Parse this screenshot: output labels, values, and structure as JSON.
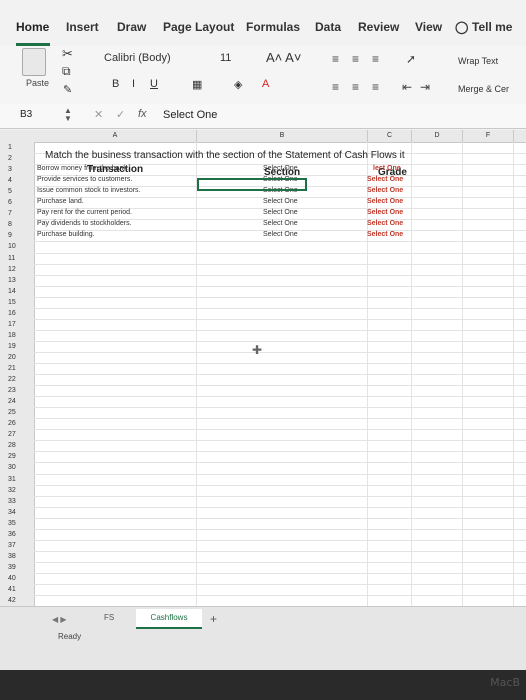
{
  "ribbon_tabs": [
    "Home",
    "Insert",
    "Draw",
    "Page Layout",
    "Formulas",
    "Data",
    "Review",
    "View",
    "Tell me"
  ],
  "ribbon": {
    "paste_label": "Paste",
    "font_name": "Calibri (Body)",
    "font_size": "11",
    "grow_label": "A˄ A˅",
    "bold": "B",
    "italic": "I",
    "underline": "U",
    "wrap_text": "Wrap Text",
    "merge": "Merge & Cer"
  },
  "formula_bar": {
    "name_box": "B3",
    "fx": "fx",
    "content": "Select One"
  },
  "columns": [
    "A",
    "B",
    "C",
    "D",
    "F"
  ],
  "rows": [
    "1",
    "2",
    "3",
    "4",
    "5",
    "6",
    "7",
    "8",
    "9",
    "10",
    "11",
    "12",
    "13",
    "14",
    "15",
    "16",
    "17",
    "18",
    "19",
    "20",
    "21",
    "22",
    "23",
    "24",
    "25",
    "26",
    "27",
    "28",
    "29",
    "30",
    "31",
    "32",
    "33",
    "34",
    "35",
    "36",
    "37",
    "38",
    "39",
    "40",
    "41",
    "42"
  ],
  "sheet": {
    "title": "Match the business transaction with the section of the Statement of Cash Flows it",
    "header_transaction": "Transaction",
    "header_section": "Section",
    "header_grade": "Grade",
    "transactions": [
      "Borrow money from the bank.",
      "Provide services to customers.",
      "Issue common stock to investors.",
      "Purchase land.",
      "Pay rent for the current period.",
      "Pay dividends to stockholders.",
      "Purchase building."
    ],
    "sections": [
      "Select One",
      "Select One",
      "Select One",
      "Select One",
      "Select One",
      "Select One",
      "Select One"
    ],
    "grades": [
      "lect One",
      "Select One",
      "Select One",
      "Select One",
      "Select One",
      "Select One",
      "Select One"
    ]
  },
  "sheet_tabs": [
    "FS",
    "Cashflows"
  ],
  "status": "Ready",
  "colors": {
    "accent": "#1e7145",
    "grade_red": "#c0392b"
  },
  "bezel_text": "MacB"
}
